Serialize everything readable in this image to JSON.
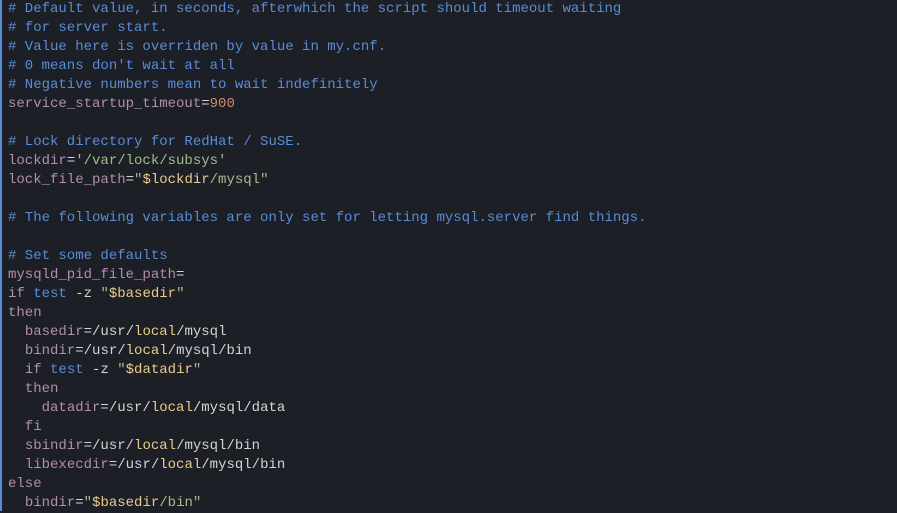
{
  "code": {
    "c1": "# Default value, in seconds, afterwhich the script should timeout waiting",
    "c2": "# for server start.",
    "c3": "# Value here is overriden by value in my.cnf.",
    "c4": "# 0 means don't wait at all",
    "c5": "# Negative numbers mean to wait indefinitely",
    "v_sst": "service_startup_timeout",
    "eq": "=",
    "n_900": "900",
    "c6": "# Lock directory for RedHat / SuSE.",
    "v_lockdir": "lockdir",
    "s_lockdir": "'/var/lock/subsys'",
    "v_lfp": "lock_file_path",
    "q": "\"",
    "sv_lockdir": "$lockdir",
    "s_mysql": "/mysql",
    "c7": "# The following variables are only set for letting mysql.server find things.",
    "c8": "# Set some defaults",
    "v_mpfp": "mysqld_pid_file_path",
    "kw_if": "if",
    "bi_test": "test",
    "flag_z": " -z ",
    "sv_basedir": "$basedir",
    "kw_then": "then",
    "v_basedir": "basedir",
    "p_usr": "/usr/",
    "p_local": "local",
    "p_mysql": "/mysql",
    "v_bindir": "bindir",
    "p_mysqlbin": "/mysql/bin",
    "sv_datadir": "$datadir",
    "v_datadir": "datadir",
    "p_mysqldata": "/mysql/data",
    "kw_fi": "fi",
    "v_sbindir": "sbindir",
    "v_libexecdir": "libexecdir",
    "kw_else": "else",
    "s_bin": "/bin",
    "sp2": "  ",
    "sp4": "    ",
    "sp": " "
  }
}
